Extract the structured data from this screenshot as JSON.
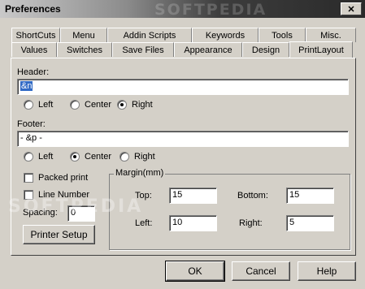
{
  "window": {
    "title": "Preferences",
    "close_glyph": "✕",
    "watermark": "SOFTPEDIA"
  },
  "tabs_row1": [
    "ShortCuts",
    "Menu",
    "Addin Scripts",
    "Keywords",
    "Tools",
    "Misc."
  ],
  "tabs_row2": [
    "Values",
    "Switches",
    "Save Files",
    "Appearance",
    "Design",
    "PrintLayout"
  ],
  "active_tab": "PrintLayout",
  "header": {
    "label": "Header:",
    "value": "&n",
    "align_options": [
      "Left",
      "Center",
      "Right"
    ],
    "selected": "Right"
  },
  "footer": {
    "label": "Footer:",
    "value": "- &p -",
    "align_options": [
      "Left",
      "Center",
      "Right"
    ],
    "selected": "Center"
  },
  "options": {
    "packed_print": "Packed print",
    "line_number": "Line Number",
    "spacing_label": "Spacing:",
    "spacing_value": "0",
    "printer_setup": "Printer Setup"
  },
  "margin": {
    "title": "Margin(mm)",
    "top_label": "Top:",
    "top": "15",
    "bottom_label": "Bottom:",
    "bottom": "15",
    "left_label": "Left:",
    "left": "10",
    "right_label": "Right:",
    "right": "5"
  },
  "buttons": {
    "ok": "OK",
    "cancel": "Cancel",
    "help": "Help"
  }
}
